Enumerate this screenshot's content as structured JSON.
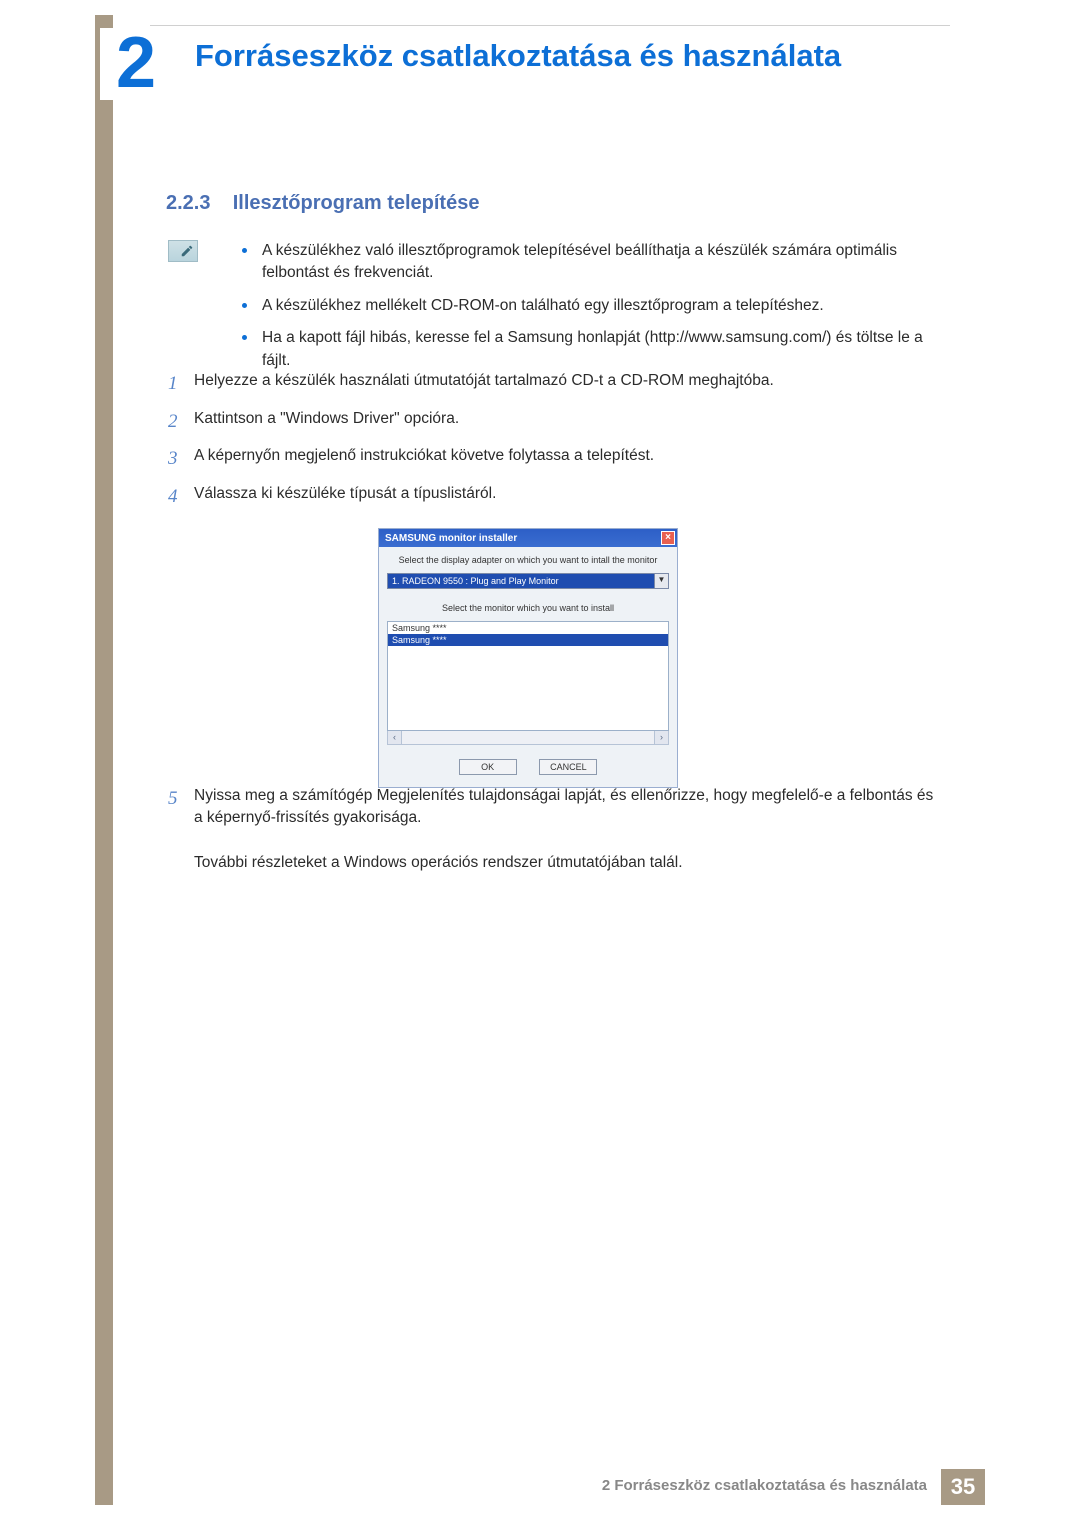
{
  "chapter": {
    "number": "2",
    "title": "Forráseszköz csatlakoztatása és használata"
  },
  "section": {
    "number": "2.2.3",
    "title": "Illesztőprogram telepítése"
  },
  "note_bullets": [
    "A készülékhez való illesztőprogramok telepítésével beállíthatja a készülék számára optimális felbontást és frekvenciát.",
    "A készülékhez mellékelt CD-ROM-on található egy illesztőprogram a telepítéshez.",
    "Ha a kapott fájl hibás, keresse fel a Samsung honlapját (http://www.samsung.com/) és töltse le a fájlt."
  ],
  "steps": {
    "s1": "Helyezze a készülék használati útmutatóját tartalmazó CD-t a CD-ROM meghajtóba.",
    "s2": "Kattintson a \"Windows Driver\" opcióra.",
    "s3": "A képernyőn megjelenő instrukciókat követve folytassa a telepítést.",
    "s4": "Válassza ki készüléke típusát a típuslistáról.",
    "s5": "Nyissa meg a számítógép Megjelenítés tulajdonságai lapját, és ellenőrizze, hogy megfelelő-e a felbontás és a képernyő-frissítés gyakorisága.",
    "s5_extra": "További részleteket a Windows operációs rendszer útmutatójában talál."
  },
  "installer": {
    "title": "SAMSUNG monitor installer",
    "msg1": "Select the display adapter on which you want to intall the monitor",
    "combo": "1. RADEON 9550 : Plug and Play Monitor",
    "msg2": "Select the monitor which you want to install",
    "items": [
      "Samsung ****",
      "Samsung ****"
    ],
    "ok": "OK",
    "cancel": "CANCEL"
  },
  "footer": {
    "text": "2 Forráseszköz csatlakoztatása és használata",
    "page": "35"
  }
}
